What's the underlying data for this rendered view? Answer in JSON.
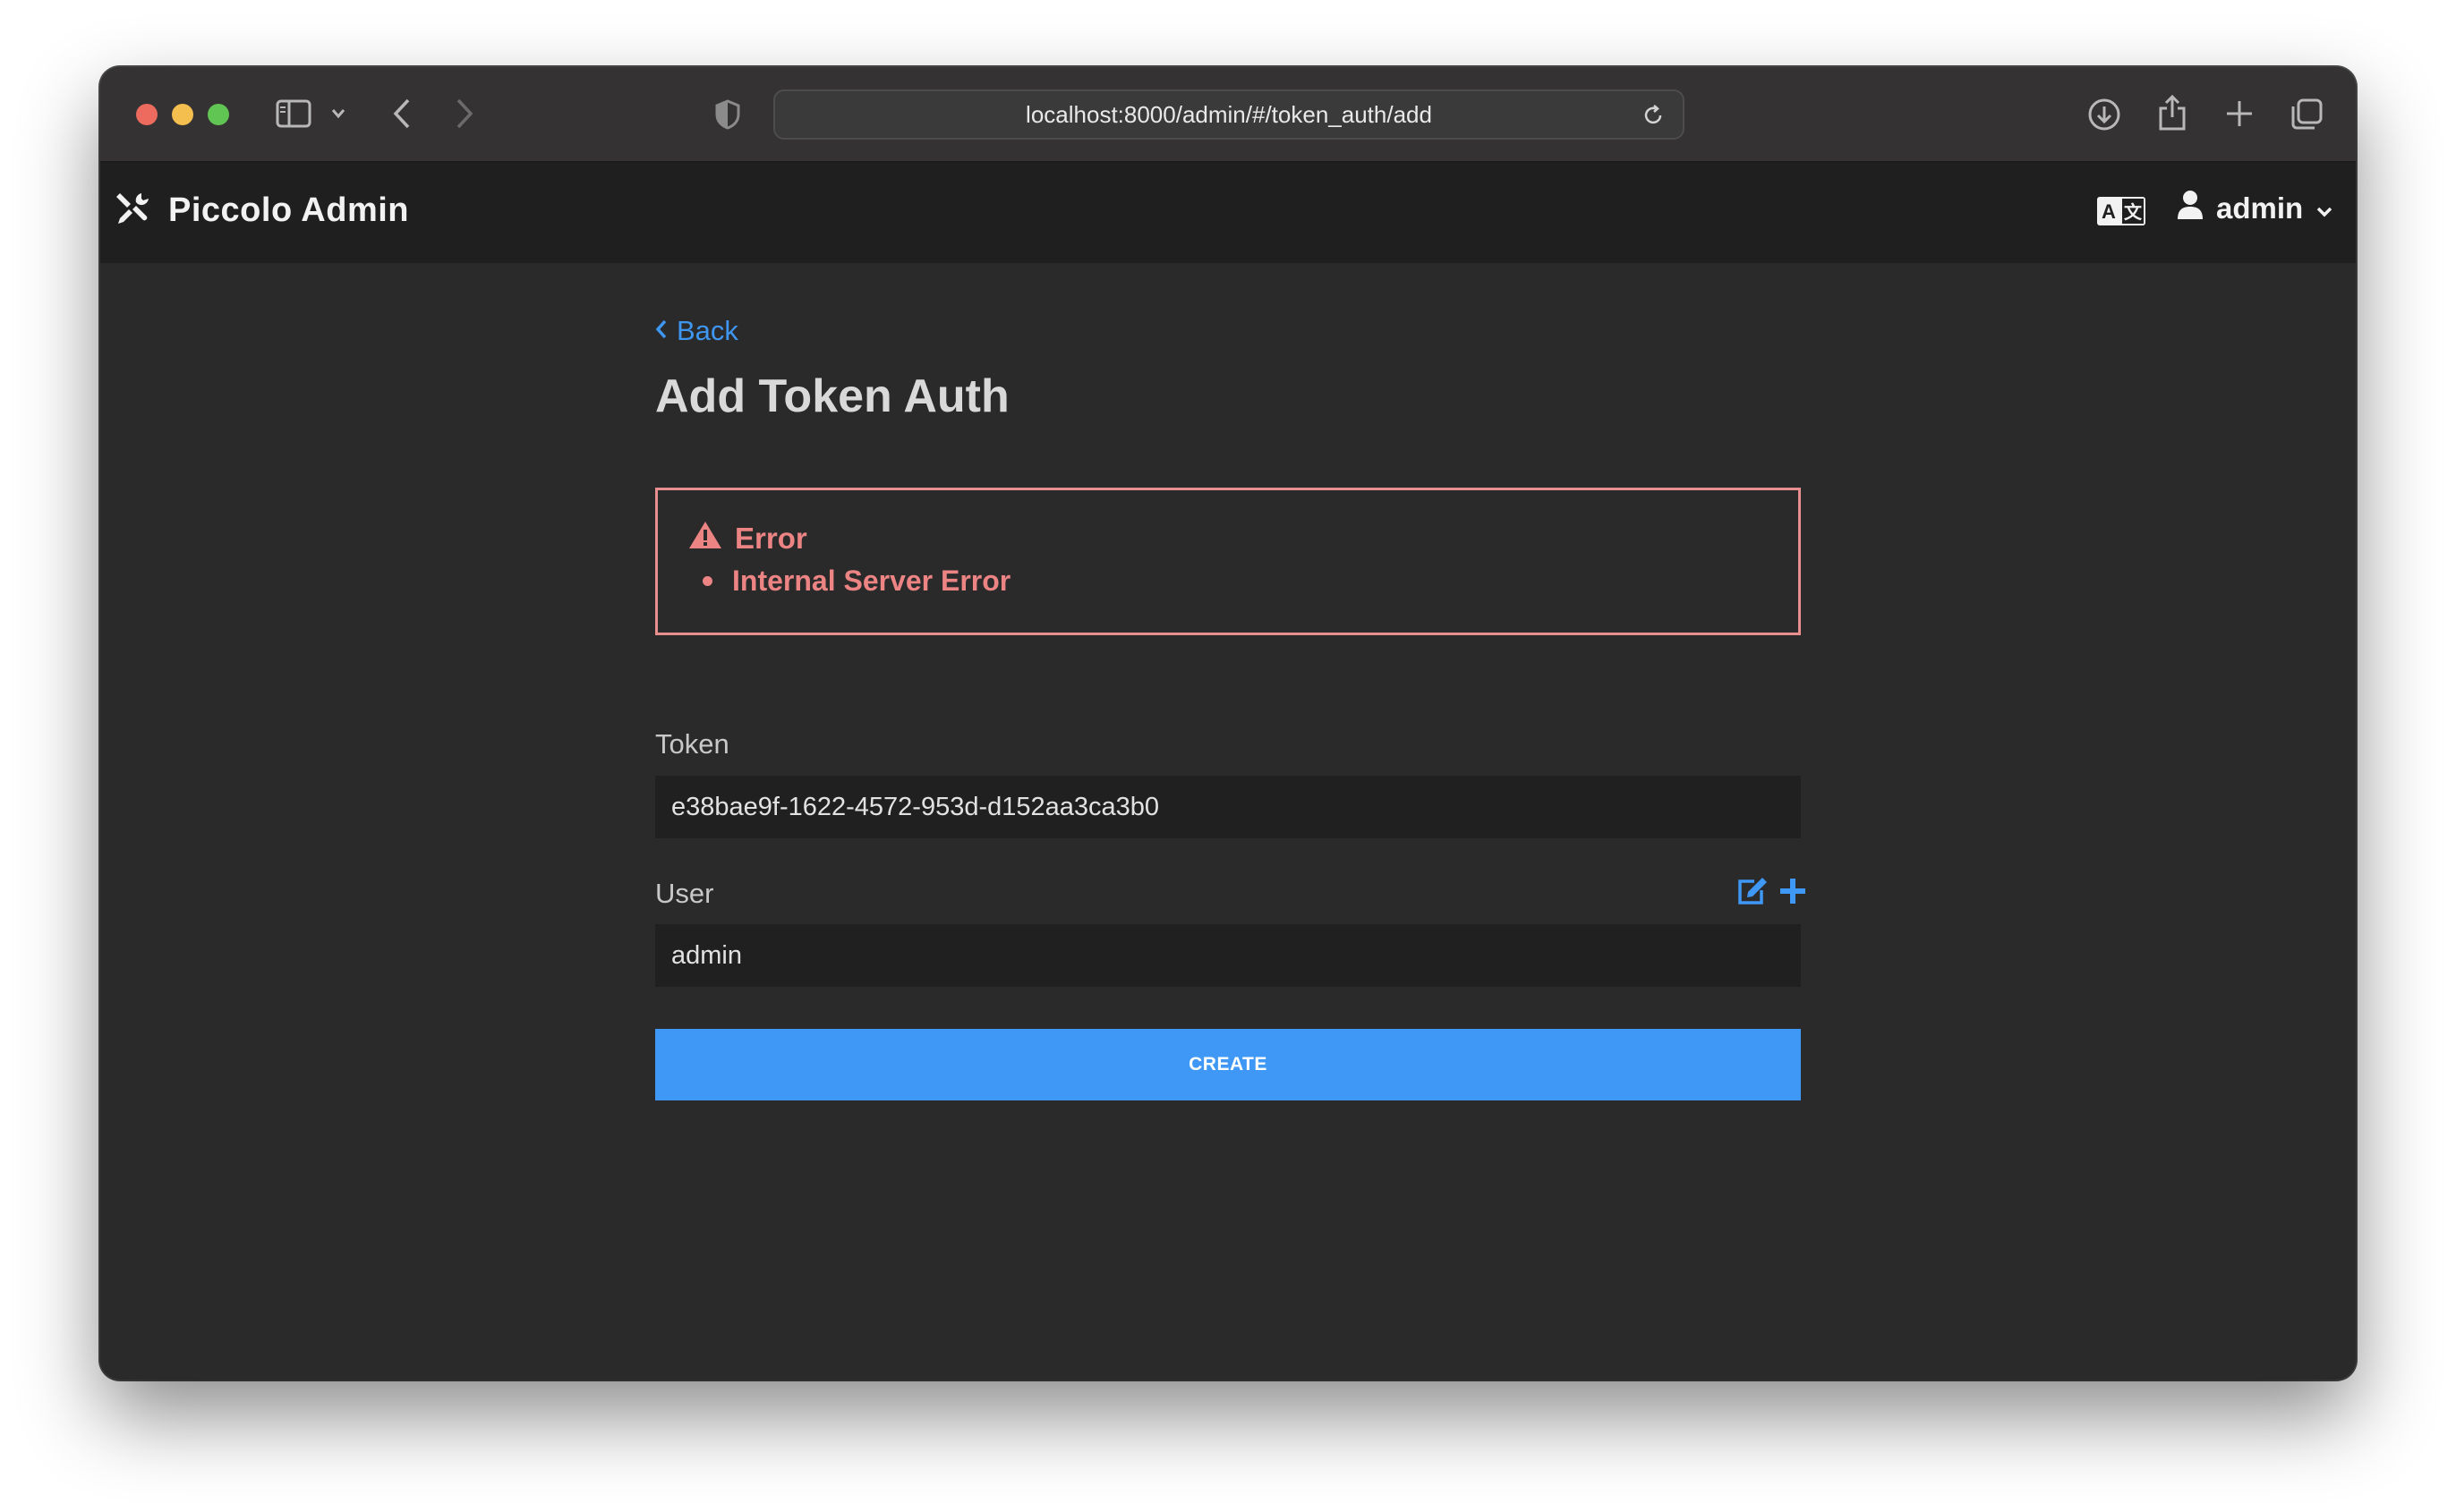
{
  "browser": {
    "url": "localhost:8000/admin/#/token_auth/add",
    "icons": [
      "sidebar-icon",
      "chevron-down-icon",
      "back-arrow-icon",
      "forward-arrow-icon",
      "shield-icon",
      "reload-icon",
      "download-icon",
      "share-icon",
      "new-tab-icon",
      "tab-overview-icon"
    ]
  },
  "header": {
    "title": "Piccolo Admin",
    "username": "admin",
    "icons": [
      "tools-icon",
      "translate-icon",
      "user-icon",
      "chevron-down-icon"
    ]
  },
  "page": {
    "back_label": "Back",
    "title": "Add Token Auth"
  },
  "error": {
    "heading": "Error",
    "messages": [
      "Internal Server Error"
    ],
    "color": "#ec8484"
  },
  "form": {
    "fields": [
      {
        "label": "Token",
        "value": "e38bae9f-1622-4572-953d-d152aa3ca3b0"
      },
      {
        "label": "User",
        "value": "admin"
      }
    ],
    "submit_label": "CREATE"
  },
  "colors": {
    "accent": "#3f98f5",
    "background": "#2a2a2b",
    "header": "#1f1f1f"
  }
}
